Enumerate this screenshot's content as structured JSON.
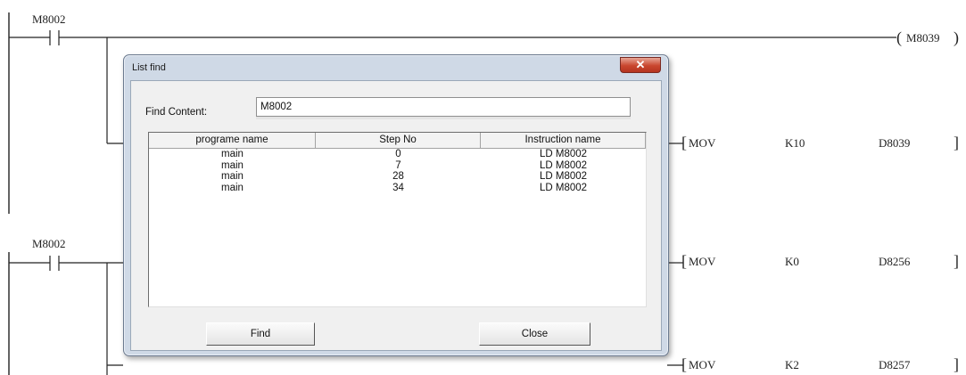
{
  "ladder": {
    "rung1_contact": "M8002",
    "rung1_coil": "M8039",
    "rung2_contact": "M8002",
    "mov_rows": [
      {
        "op": "MOV",
        "src": "K10",
        "dst": "D8039"
      },
      {
        "op": "MOV",
        "src": "K0",
        "dst": "D8256"
      },
      {
        "op": "MOV",
        "src": "K2",
        "dst": "D8257"
      }
    ]
  },
  "dialog": {
    "title": "List find",
    "close_glyph": "✕",
    "find_label": "Find Content:",
    "find_value": "M8002",
    "columns": [
      "programe name",
      "Step No",
      "Instruction name"
    ],
    "rows": [
      [
        "main",
        "0",
        "LD M8002"
      ],
      [
        "main",
        "7",
        "LD M8002"
      ],
      [
        "main",
        "28",
        "LD M8002"
      ],
      [
        "main",
        "34",
        "LD M8002"
      ]
    ],
    "find_button": "Find",
    "close_button": "Close"
  }
}
